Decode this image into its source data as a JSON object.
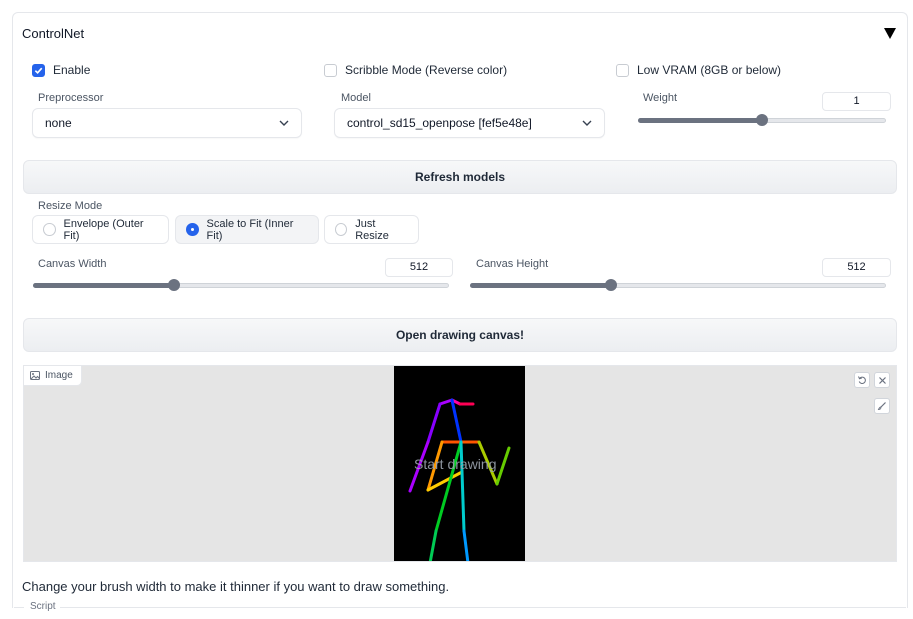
{
  "panel": {
    "title": "ControlNet"
  },
  "options": {
    "enable": {
      "label": "Enable",
      "checked": true
    },
    "scribble": {
      "label": "Scribble Mode (Reverse color)",
      "checked": false
    },
    "lowvram": {
      "label": "Low VRAM (8GB or below)",
      "checked": false
    }
  },
  "preprocessor": {
    "label": "Preprocessor",
    "value": "none"
  },
  "model": {
    "label": "Model",
    "value": "control_sd15_openpose [fef5e48e]"
  },
  "weight": {
    "label": "Weight",
    "value": "1",
    "fraction": 0.5
  },
  "buttons": {
    "refresh": "Refresh models",
    "open_canvas": "Open drawing canvas!"
  },
  "resize_mode": {
    "label": "Resize Mode",
    "options": [
      "Envelope (Outer Fit)",
      "Scale to Fit (Inner Fit)",
      "Just Resize"
    ],
    "selected": "Scale to Fit (Inner Fit)"
  },
  "canvas_width": {
    "label": "Canvas Width",
    "value": "512",
    "fraction": 0.34
  },
  "canvas_height": {
    "label": "Canvas Height",
    "value": "512",
    "fraction": 0.34
  },
  "image": {
    "tag": "Image",
    "overlay_text": "Start drawing"
  },
  "hint": "Change your brush width to make it thinner if you want to draw something.",
  "script": {
    "label": "Script"
  },
  "colors": {
    "accent": "#2563eb",
    "slider": "#6b7280"
  }
}
